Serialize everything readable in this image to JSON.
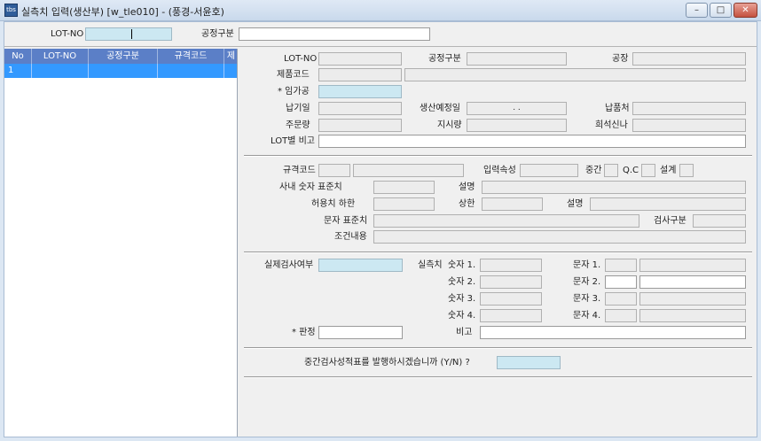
{
  "window": {
    "icon_text": "tbs",
    "title": "실측치 입력(생산부) [w_tle010] - (풍경-서윤호)",
    "minimize": "–",
    "maximize": "□",
    "close": "✕"
  },
  "topbar": {
    "lot_no_label": "LOT-NO",
    "lot_no_value": "",
    "process_label": "공정구분",
    "process_value": ""
  },
  "grid": {
    "columns": [
      "No",
      "LOT-NO",
      "공정구분",
      "규격코드",
      "제"
    ],
    "rows": [
      {
        "no": "1",
        "lot_no": "",
        "process": "",
        "spec": "",
        "extra": ""
      }
    ]
  },
  "form": {
    "section1": {
      "lot_no_label": "LOT-NO",
      "process_label": "공정구분",
      "factory_label": "공장",
      "product_code_label": "제품코드",
      "temp_label": "* 임가공",
      "delivery_label": "납기일",
      "plan_date_label": "생산예정일",
      "plan_date_value": ". .",
      "ship_to_label": "납품처",
      "order_qty_label": "주문량",
      "instruct_qty_label": "지시량",
      "thinner_label": "희석신나",
      "lot_note_label": "LOT별 비고"
    },
    "section2": {
      "spec_code_label": "규격코드",
      "input_attr_label": "입력속성",
      "mid_label": "중간",
      "qc_label": "Q.C",
      "setup_label": "설계",
      "inner_std_label": "사내 숫자 표준치",
      "desc_label": "설명",
      "tol_low_label": "허용치 하한",
      "upper_label": "상한",
      "desc2_label": "설명",
      "char_std_label": "문자 표준치",
      "inspect_type_label": "검사구분",
      "condition_label": "조건내용"
    },
    "section3": {
      "actual_inspect_label": "실제검사여부",
      "measure_label": "실측치",
      "num1_label": "숫자 1.",
      "num2_label": "숫자 2.",
      "num3_label": "숫자 3.",
      "num4_label": "숫자 4.",
      "char1_label": "문자 1.",
      "char2_label": "문자 2.",
      "char3_label": "문자 3.",
      "char4_label": "문자 4.",
      "judge_label": "* 판정",
      "note_label": "비고"
    },
    "section4": {
      "issue_question": "중간검사성적표를 발행하시겠습니까 (Y/N) ?"
    }
  }
}
